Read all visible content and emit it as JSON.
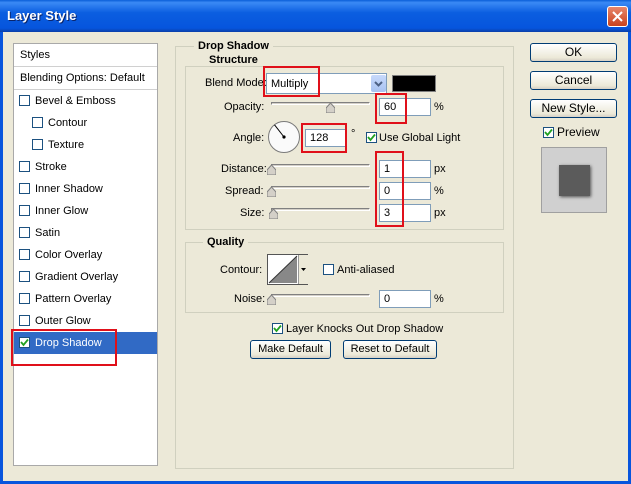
{
  "window": {
    "title": "Layer Style"
  },
  "styles_list": {
    "header": "Styles",
    "blending": "Blending Options: Default",
    "items": [
      {
        "label": "Bevel & Emboss",
        "checked": false
      },
      {
        "label": "Contour",
        "checked": false
      },
      {
        "label": "Texture",
        "checked": false
      },
      {
        "label": "Stroke",
        "checked": false
      },
      {
        "label": "Inner Shadow",
        "checked": false
      },
      {
        "label": "Inner Glow",
        "checked": false
      },
      {
        "label": "Satin",
        "checked": false
      },
      {
        "label": "Color Overlay",
        "checked": false
      },
      {
        "label": "Gradient Overlay",
        "checked": false
      },
      {
        "label": "Pattern Overlay",
        "checked": false
      },
      {
        "label": "Outer Glow",
        "checked": false
      },
      {
        "label": "Drop Shadow",
        "checked": true,
        "selected": true
      }
    ]
  },
  "drop_shadow": {
    "title": "Drop Shadow",
    "structure": {
      "title": "Structure",
      "blend_mode_label": "Blend Mode:",
      "blend_mode_value": "Multiply",
      "shadow_color": "#000000",
      "opacity_label": "Opacity:",
      "opacity_value": "60",
      "opacity_unit": "%",
      "angle_label": "Angle:",
      "angle_value": "128",
      "angle_unit": "°",
      "global_light_label": "Use Global Light",
      "global_light_checked": true,
      "distance_label": "Distance:",
      "distance_value": "1",
      "distance_unit": "px",
      "spread_label": "Spread:",
      "spread_value": "0",
      "spread_unit": "%",
      "size_label": "Size:",
      "size_value": "3",
      "size_unit": "px"
    },
    "quality": {
      "title": "Quality",
      "contour_label": "Contour:",
      "anti_aliased_label": "Anti-aliased",
      "anti_aliased_checked": false,
      "noise_label": "Noise:",
      "noise_value": "0",
      "noise_unit": "%"
    },
    "knockout_label": "Layer Knocks Out Drop Shadow",
    "knockout_checked": true,
    "make_default": "Make Default",
    "reset_default": "Reset to Default"
  },
  "buttons": {
    "ok": "OK",
    "cancel": "Cancel",
    "new_style": "New Style...",
    "preview_label": "Preview",
    "preview_checked": true
  },
  "colors": {
    "selection": "#316ac5",
    "annotation": "#e0101a"
  }
}
